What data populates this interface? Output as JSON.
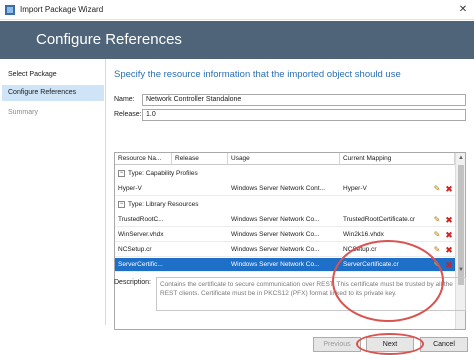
{
  "window": {
    "title": "Import Package Wizard",
    "close_glyph": "✕"
  },
  "banner": {
    "title": "Configure References"
  },
  "sidebar": {
    "items": [
      {
        "label": "Select Package",
        "state": "normal"
      },
      {
        "label": "Configure References",
        "state": "active"
      },
      {
        "label": "Summary",
        "state": "disabled"
      }
    ]
  },
  "main": {
    "heading": "Specify the resource information that the imported object should use",
    "name_label": "Name:",
    "name_value": "Network Controller Standalone",
    "release_label": "Release:",
    "release_value": "1.0"
  },
  "grid": {
    "columns": [
      "Resource Na...",
      "Release",
      "Usage",
      "Current Mapping"
    ],
    "groups": [
      {
        "label": "Type:  Capability Profiles",
        "rows": [
          {
            "name": "Hyper-V",
            "release": "",
            "usage": "Windows Server Network Cont...",
            "mapping": "Hyper-V",
            "selected": false
          }
        ]
      },
      {
        "label": "Type:  Library Resources",
        "rows": [
          {
            "name": "TrustedRootC...",
            "release": "",
            "usage": "Windows Server Network Co...",
            "mapping": "TrustedRootCertificate.cr",
            "selected": false
          },
          {
            "name": "WinServer.vhdx",
            "release": "",
            "usage": "Windows Server Network Co...",
            "mapping": "Win2k16.vhdx",
            "selected": false
          },
          {
            "name": "NCSetup.cr",
            "release": "",
            "usage": "Windows Server Network Co...",
            "mapping": "NCSetup.cr",
            "selected": false
          },
          {
            "name": "ServerCertific...",
            "release": "",
            "usage": "Windows Server Network Co...",
            "mapping": "ServerCertificate.cr",
            "selected": true
          }
        ]
      }
    ],
    "collapse_glyph": "−",
    "edit_glyph": "✎",
    "delete_glyph": "✖",
    "scroll_up": "▲",
    "scroll_down": "▼"
  },
  "description": {
    "label": "Description:",
    "text": "Contains the certificate to secure communication over REST. This certificate must be trusted by all the REST clients. Certificate must be in PKCS12 (PFX) format linked to its private key."
  },
  "footer": {
    "previous_label": "Previous",
    "next_label": "Next",
    "cancel_label": "Cancel"
  },
  "colors": {
    "banner": "#4f6479",
    "accent": "#2c6fb3",
    "selection": "#1e6fc8",
    "annotation": "#d9534f"
  }
}
